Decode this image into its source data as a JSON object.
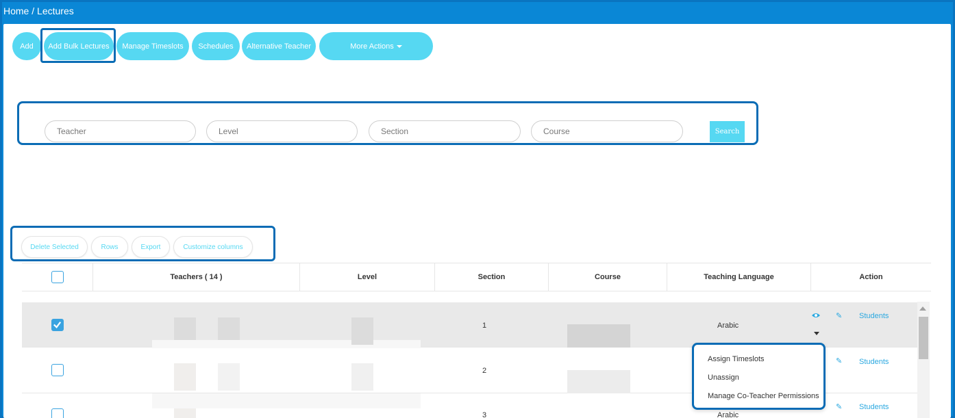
{
  "breadcrumb": {
    "home": "Home",
    "separator": "/",
    "current": "Lectures"
  },
  "toolbar": {
    "add": "Add",
    "add_bulk": "Add Bulk Lectures",
    "manage_timeslots": "Manage Timeslots",
    "schedules": "Schedules",
    "alternative_teacher": "Alternative Teacher",
    "more_actions": "More Actions"
  },
  "filters": {
    "teacher": "Teacher",
    "level": "Level",
    "section": "Section",
    "course": "Course",
    "search": "Search"
  },
  "table_tools": {
    "delete_selected": "Delete Selected",
    "rows": "Rows",
    "export": "Export",
    "customize_columns": "Customize columns"
  },
  "table": {
    "headers": {
      "teachers": "Teachers ( 14 )",
      "level": "Level",
      "section": "Section",
      "course": "Course",
      "teaching_language": "Teaching Language",
      "action": "Action"
    },
    "rows": [
      {
        "section": "1",
        "language": "Arabic",
        "checked": true,
        "students": "Students"
      },
      {
        "section": "2",
        "language": "",
        "checked": false,
        "students": "Students"
      },
      {
        "section": "3",
        "language": "Arabic",
        "checked": false,
        "students": "Students"
      }
    ]
  },
  "action_menu": {
    "assign_timeslots": "Assign Timeslots",
    "unassign": "Unassign",
    "manage_co_teacher": "Manage Co-Teacher Permissions"
  },
  "colors": {
    "accent": "#56d8f2",
    "header_bar": "#0a87d6",
    "link": "#2aa8e0"
  }
}
